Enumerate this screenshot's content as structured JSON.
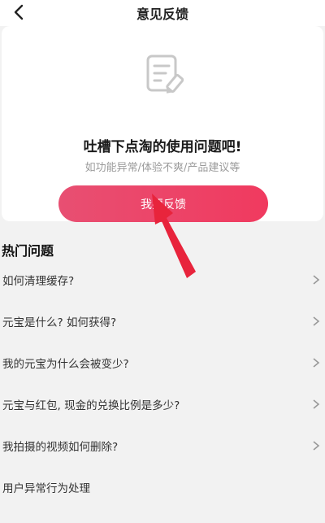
{
  "header": {
    "title": "意见反馈"
  },
  "card": {
    "title": "吐槽下点淘的使用问题吧!",
    "subtitle": "如功能异常/体验不爽/产品建议等",
    "button_label": "我要反馈"
  },
  "faq": {
    "section_title": "热门问题",
    "items": [
      {
        "label": "如何清理缓存?",
        "has_chevron": true
      },
      {
        "label": "元宝是什么? 如何获得?",
        "has_chevron": true
      },
      {
        "label": "我的元宝为什么会被变少?",
        "has_chevron": true
      },
      {
        "label": "元宝与红包, 现金的兑换比例是多少?",
        "has_chevron": true
      },
      {
        "label": "我拍摄的视频如何删除?",
        "has_chevron": true
      },
      {
        "label": "用户异常行为处理",
        "has_chevron": false
      }
    ]
  },
  "colors": {
    "accent": "#f03a5f",
    "arrow": "#e8243c",
    "background": "#f2f2f2",
    "card": "#ffffff",
    "subtitle_text": "#9a9a9a"
  },
  "icons": {
    "back": "chevron-left-icon",
    "document": "document-edit-icon",
    "row": "chevron-right-icon",
    "annotation": "red-arrow-icon"
  }
}
